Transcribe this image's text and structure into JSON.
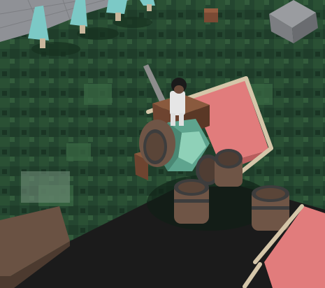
{
  "scene": {
    "name": "voxel-island-game-view",
    "colors": {
      "grass_dark": "#1d3a28",
      "grass_mid": "#2b5135",
      "grass_light": "#3d6a43",
      "void": "#1b1b1b",
      "stone_floor": "#8f9196",
      "dirt": "#6a5243",
      "wood_frame": "#d5c6a9",
      "sail_red": "#e17c7c",
      "sail_red_shade": "#b95d5d",
      "teal_crystal": "#5ea48e",
      "barrel_wood": "#6f5546",
      "barrel_ring": "#3d3d3d",
      "crate": "#7a4a34",
      "tree_leaves": "#7cc9c6",
      "grey_block": "#8a8c90"
    }
  },
  "objects": {
    "trees": [
      {
        "icon": "tree-icon"
      },
      {
        "icon": "tree-icon"
      },
      {
        "icon": "tree-icon"
      },
      {
        "icon": "tree-icon"
      }
    ],
    "barrels": [
      {
        "icon": "barrel-icon"
      },
      {
        "icon": "barrel-icon"
      },
      {
        "icon": "barrel-icon"
      },
      {
        "icon": "barrel-icon"
      },
      {
        "icon": "barrel-icon"
      }
    ],
    "player": {
      "icon": "player-character-icon"
    },
    "cart": {
      "icon": "sail-cart-icon"
    }
  }
}
